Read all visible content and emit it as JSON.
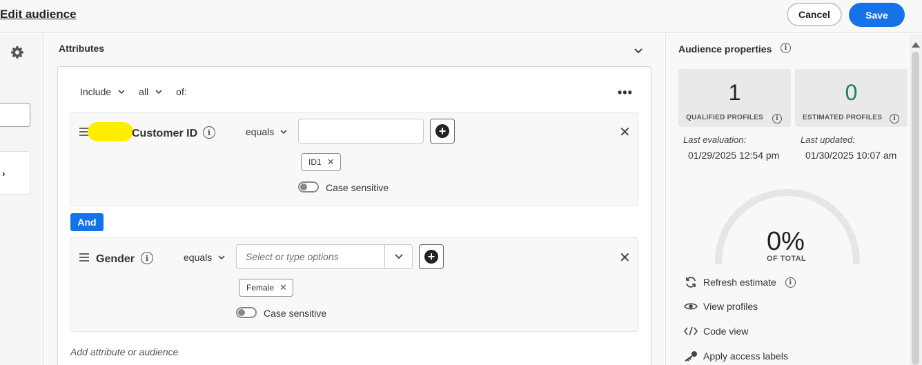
{
  "header": {
    "title": "Edit audience",
    "cancel_label": "Cancel",
    "save_label": "Save"
  },
  "attributes": {
    "title": "Attributes",
    "include_label": "Include",
    "all_label": "all",
    "of_label": "of:",
    "and_label": "And",
    "add_placeholder": "Add attribute or audience",
    "conditions": [
      {
        "name": "Customer ID",
        "operator": "equals",
        "input_value": "",
        "tags": [
          "ID1"
        ],
        "case_label": "Case sensitive",
        "case_sensitive": false
      },
      {
        "name": "Gender",
        "operator": "equals",
        "placeholder": "Select or type options",
        "tags": [
          "Female"
        ],
        "case_label": "Case sensitive",
        "case_sensitive": false
      }
    ]
  },
  "properties": {
    "title": "Audience properties",
    "qualified": {
      "value": "1",
      "label": "QUALIFIED PROFILES"
    },
    "estimated": {
      "value": "0",
      "label": "ESTIMATED PROFILES"
    },
    "last_evaluation_label": "Last evaluation:",
    "last_evaluation_value": "01/29/2025 12:54 pm",
    "last_updated_label": "Last updated:",
    "last_updated_value": "01/30/2025 10:07 am",
    "percent": "0%",
    "percent_label": "OF TOTAL",
    "actions": [
      "Refresh estimate",
      "View profiles",
      "Code view",
      "Apply access labels"
    ]
  },
  "colors": {
    "accent": "#1473e6",
    "estimated": "#1a8458",
    "highlight": "#ffee00"
  },
  "icons": [
    "gear-icon",
    "chevron-down-icon",
    "more-icon",
    "drag-handle-icon",
    "info-icon",
    "add-icon",
    "close-icon",
    "refresh-icon",
    "eye-icon",
    "code-icon",
    "key-icon"
  ]
}
